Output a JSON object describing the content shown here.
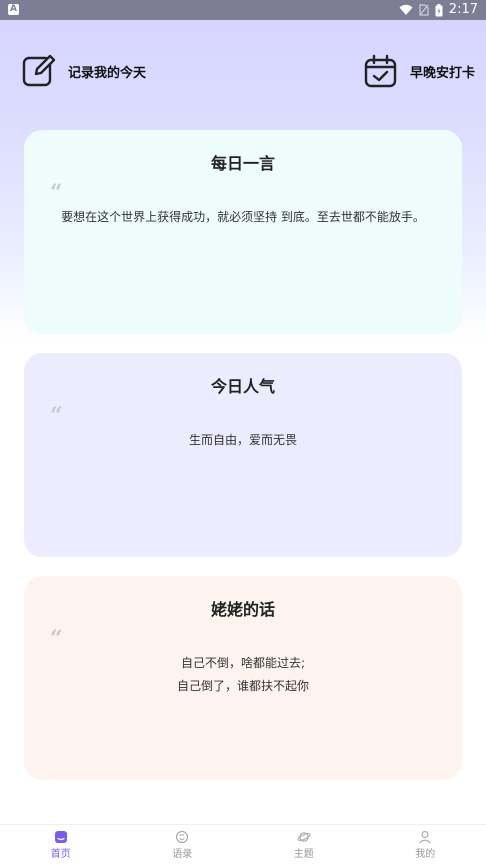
{
  "status_bar": {
    "time": "2:17",
    "app_badge": "A"
  },
  "top": {
    "left_label": "记录我的今天",
    "right_label": "早晚安打卡"
  },
  "cards": [
    {
      "title": "每日一言",
      "quote_mark": "“",
      "lines": [
        "要想在这个世界上获得成功，就必须坚持 到底。至去世都不能放手。"
      ],
      "bg": "#effcfc"
    },
    {
      "title": "今日人气",
      "quote_mark": "“",
      "lines": [
        "生而自由，爱而无畏"
      ],
      "bg": "#ececfe"
    },
    {
      "title": "姥姥的话",
      "quote_mark": "“",
      "lines": [
        "自己不倒，啥都能过去;",
        "自己倒了，谁都扶不起你"
      ],
      "bg": "#fdf3ef"
    }
  ],
  "nav": {
    "items": [
      {
        "label": "首页",
        "icon": "home-icon",
        "active": true
      },
      {
        "label": "语录",
        "icon": "quote-icon",
        "active": false
      },
      {
        "label": "主题",
        "icon": "planet-icon",
        "active": false
      },
      {
        "label": "我的",
        "icon": "user-icon",
        "active": false
      }
    ]
  },
  "colors": {
    "accent": "#7b5cf0",
    "status_bar": "#7d7d95"
  }
}
